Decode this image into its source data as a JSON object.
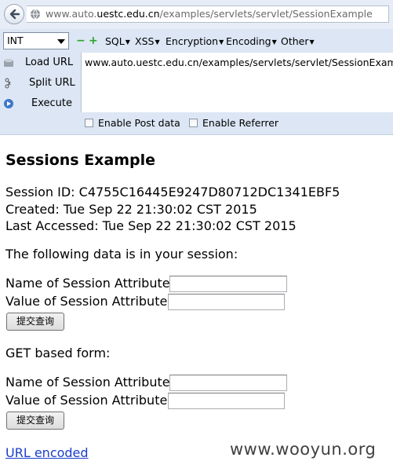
{
  "browser": {
    "url_prefix": "www.auto.",
    "url_host": "uestc.edu.cn",
    "url_path": "/examples/servlets/servlet/SessionExample"
  },
  "hackbar": {
    "select_value": "INT",
    "menus": [
      "SQL",
      "XSS",
      "Encryption",
      "Encoding",
      "Other"
    ],
    "load_url": "Load URL",
    "split_url": "Split URL",
    "execute": "Execute",
    "url_text": "www.auto.uestc.edu.cn/examples/servlets/servlet/SessionExample",
    "enable_post": "Enable Post data",
    "enable_referrer": "Enable Referrer"
  },
  "page": {
    "title": "Sessions Example",
    "session_id": "Session ID: C4755C16445E9247D80712DC1341EBF5",
    "created": "Created: Tue Sep 22 21:30:02 CST 2015",
    "last_accessed": "Last Accessed: Tue Sep 22 21:30:02 CST 2015",
    "data_intro": "The following data is in your session:",
    "name_label": "Name of Session Attribute:",
    "value_label": "Value of Session Attribute:",
    "submit_label": "提交查询",
    "get_form_label": "GET based form:",
    "url_encoded_link": "URL encoded"
  },
  "watermark": "www.wooyun.org",
  "colors": {
    "hackbar_bg": "#dce6f4",
    "link": "#1a3ec8"
  }
}
